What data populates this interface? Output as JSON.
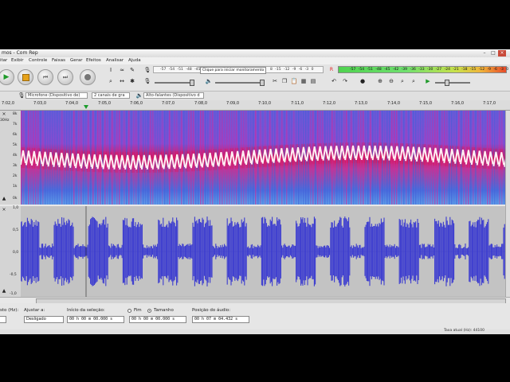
{
  "window": {
    "title": "mos - Com Rep"
  },
  "menu": [
    "itar",
    "Exibir",
    "Controle",
    "Faixas",
    "Gerar",
    "Efeitos",
    "Analisar",
    "Ajuda"
  ],
  "transport": [
    "play",
    "pause",
    "skip-start",
    "skip-end",
    "record"
  ],
  "meters": {
    "record_scale": "-57 -54 -51 -48 -45",
    "record_hint": "Clique para iniciar monitoramento",
    "record_scale_right": "8 -15 -12 -9 -6 -3 0",
    "play_scale": "-57 -54 -51 -48 -45 -42 -39 -36 -33 -30 -27 -24 -21 -18 -15 -12 -9 -6 -3 0",
    "record_label": "R",
    "play_label": "E"
  },
  "devices": {
    "mic": "Microfone (Dispositivo de)",
    "channels": "2 canais de gra",
    "speakers": "Alto-falantes (Dispositivo d"
  },
  "ruler": [
    "7:02,0",
    "7:03,0",
    "7:04,0",
    "7:05,0",
    "7:06,0",
    "7:07,0",
    "7:08,0",
    "7:09,0",
    "7:10,0",
    "7:11,0",
    "7:12,0",
    "7:13,0",
    "7:14,0",
    "7:15,0",
    "7:16,0",
    "7:17,0"
  ],
  "spectrogram_scale": [
    "8k",
    "7k",
    "6k",
    "5k",
    "4k",
    "3k",
    "2k",
    "1k",
    "0k"
  ],
  "spectrogram_side": "30Hz",
  "wave_scale": [
    "1,0",
    "0,5",
    "0,0",
    "-0,5",
    "-1,0"
  ],
  "selection": {
    "rate_label": "sto (Hz):",
    "snap_label": "Ajustar a:",
    "snap_value": "Desligado",
    "start_label": "Início da seleção:",
    "start_value": "00 h 00 m 00.000 s",
    "end_label": "Fim",
    "length_label": "Tamanho",
    "length_value": "00 h 00 m 00.000 s",
    "pos_label": "Posição do áudio:",
    "pos_value": "00 h 07 m 04.432 s"
  },
  "status": {
    "text": "Taxa atual (Hz): 44100"
  },
  "colors": {
    "spectrogram_bg": "#4a6ddd",
    "spectrogram_hot": "#e01050",
    "waveform": "#3a3ad0",
    "waveform_bg": "#c3c3c3"
  }
}
